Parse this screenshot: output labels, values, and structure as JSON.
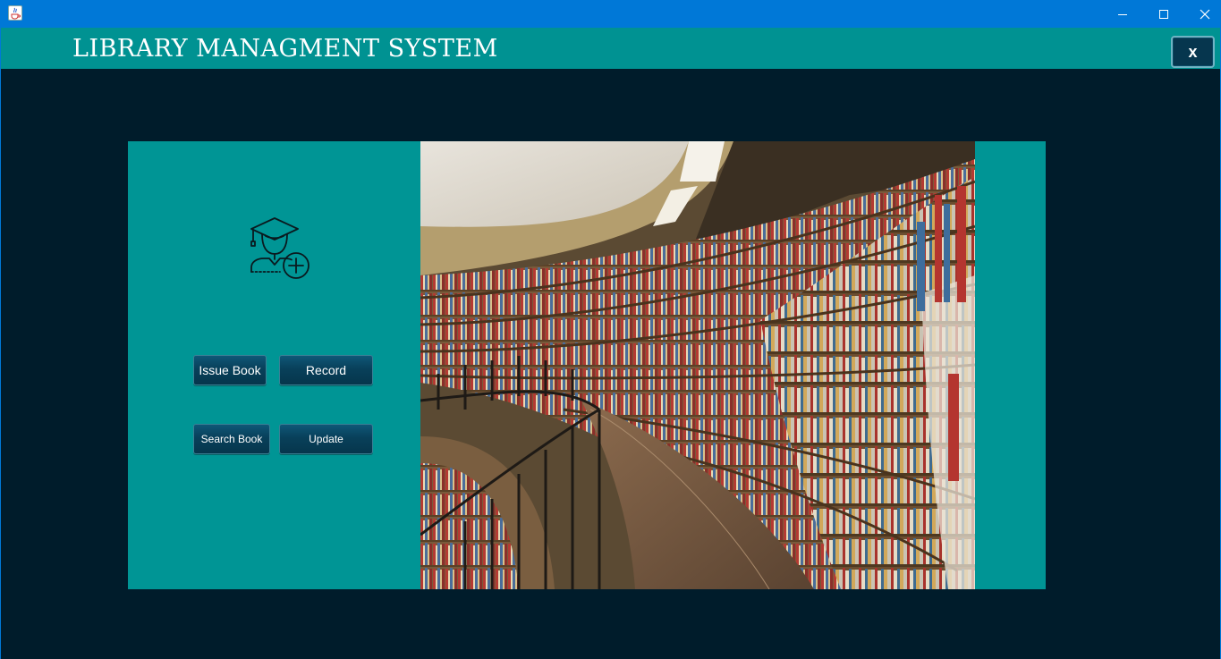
{
  "window": {
    "minimize_glyph": "—",
    "maximize_glyph": "☐",
    "close_glyph": "✕"
  },
  "header": {
    "title": "LIBRARY MANAGMENT SYSTEM",
    "close_label": "x"
  },
  "menu": {
    "issue_book": "Issue Book",
    "record": "Record",
    "search_book": "Search Book",
    "update": "Update"
  },
  "icons": {
    "app_icon": "java-cup-icon",
    "user_icon": "graduate-add-user-icon",
    "photo": "library-bookshelf-photo"
  },
  "colors": {
    "background": "#001c2b",
    "header": "#009292",
    "panel": "#009595",
    "button": "#08405a",
    "titlebar": "#0078d7"
  }
}
